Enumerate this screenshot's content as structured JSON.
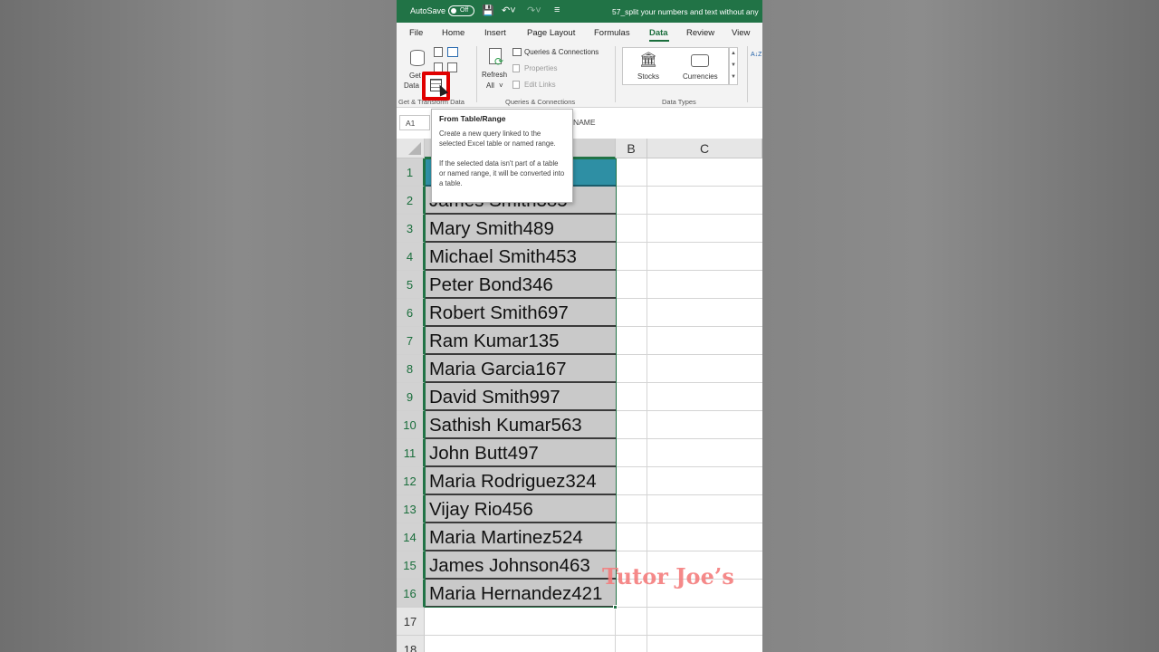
{
  "titlebar": {
    "autosave_label": "AutoSave",
    "autosave_state": "Off",
    "title": "57_split your numbers and text without any"
  },
  "tabs": [
    {
      "label": "File"
    },
    {
      "label": "Home"
    },
    {
      "label": "Insert"
    },
    {
      "label": "Page Layout"
    },
    {
      "label": "Formulas"
    },
    {
      "label": "Data"
    },
    {
      "label": "Review"
    },
    {
      "label": "View"
    }
  ],
  "active_tab": "Data",
  "ribbon": {
    "get_data_line1": "Get",
    "get_data_line2": "Data",
    "get_transform_label": "Get & Transform Data",
    "refresh_line1": "Refresh",
    "refresh_line2": "All",
    "queries_connections": "Queries & Connections",
    "properties": "Properties",
    "edit_links": "Edit Links",
    "queries_group_label": "Queries & Connections",
    "stocks": "Stocks",
    "currencies": "Currencies",
    "data_types_label": "Data Types",
    "sort_az": "A↓Z"
  },
  "formula_bar": {
    "name_box": "A1",
    "content": "NAME"
  },
  "tooltip": {
    "title": "From Table/Range",
    "para1": "Create a new query linked to the selected Excel table or named range.",
    "para2": "If the selected data isn't part of a table or named range, it will be converted into a table."
  },
  "columns": [
    "B",
    "C"
  ],
  "rows": [
    {
      "num": "1",
      "value": ""
    },
    {
      "num": "2",
      "value": "James Smith385"
    },
    {
      "num": "3",
      "value": "Mary Smith489"
    },
    {
      "num": "4",
      "value": "Michael Smith453"
    },
    {
      "num": "5",
      "value": "Peter Bond346"
    },
    {
      "num": "6",
      "value": "Robert Smith697"
    },
    {
      "num": "7",
      "value": "Ram Kumar135"
    },
    {
      "num": "8",
      "value": "Maria Garcia167"
    },
    {
      "num": "9",
      "value": "David Smith997"
    },
    {
      "num": "10",
      "value": "Sathish Kumar563"
    },
    {
      "num": "11",
      "value": "John Butt497"
    },
    {
      "num": "12",
      "value": "Maria Rodriguez324"
    },
    {
      "num": "13",
      "value": "Vijay Rio456"
    },
    {
      "num": "14",
      "value": "Maria Martinez524"
    },
    {
      "num": "15",
      "value": "James Johnson463"
    },
    {
      "num": "16",
      "value": "Maria Hernandez421"
    }
  ],
  "empty_rows": [
    "17",
    "18"
  ],
  "watermark": "Tutor Joe’s",
  "colors": {
    "excel_green": "#217346",
    "header_cell": "#2e8fa4",
    "highlight_red": "#e00000",
    "watermark": "#f47d7d"
  }
}
